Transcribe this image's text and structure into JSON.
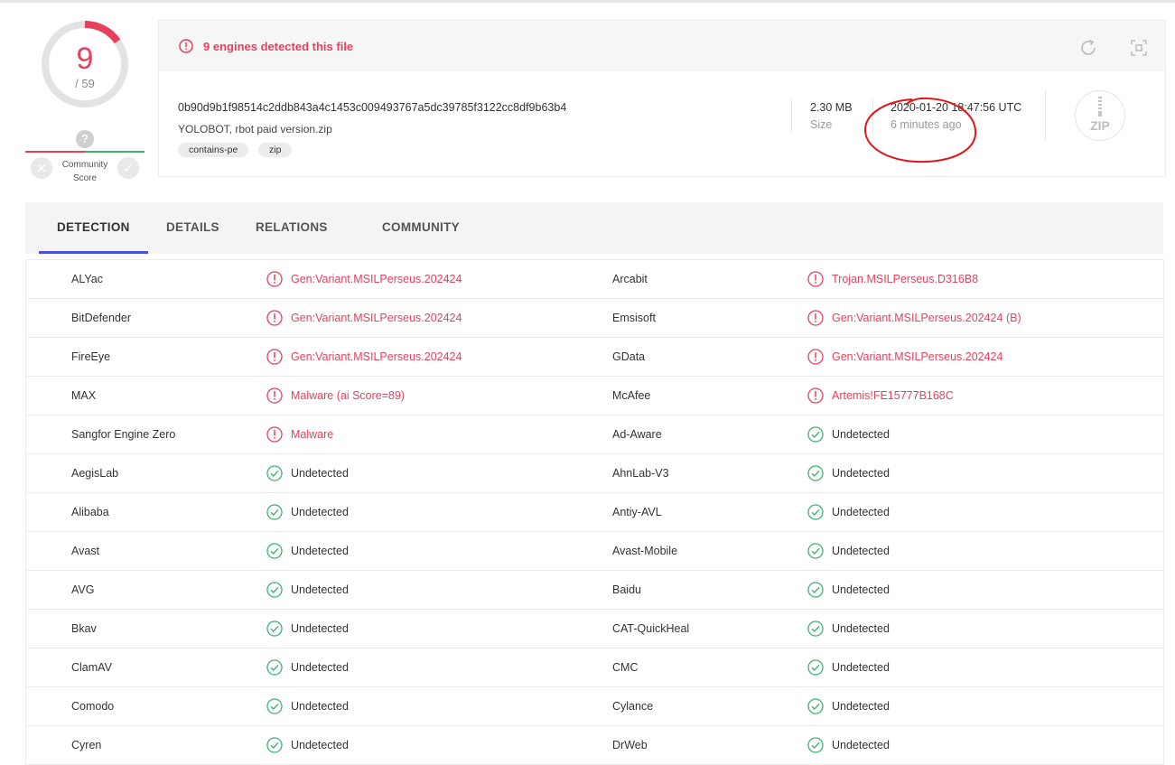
{
  "score": {
    "detected": "9",
    "total": "/ 59",
    "community_label": "Community Score",
    "community_q": "?"
  },
  "header": {
    "alert_text": "9 engines detected this file",
    "hash": "0b90d9b1f98514c2ddb843a4c1453c009493767a5dc39785f3122cc8df9b63b4",
    "filename": "YOLOBOT, rbot paid version.zip",
    "tags": [
      "contains-pe",
      "zip"
    ],
    "size_value": "2.30 MB",
    "size_label": "Size",
    "date_value": "2020-01-20 18:47:56 UTC",
    "date_label": "6 minutes ago",
    "file_type": "ZIP"
  },
  "tabs": [
    "DETECTION",
    "DETAILS",
    "RELATIONS",
    "COMMUNITY"
  ],
  "colors": {
    "detected": "#e5415d",
    "clean": "#3eb273",
    "tab_accent": "#4b4fe2",
    "annotation": "#e0161b"
  },
  "detections": [
    {
      "l_engine": "ALYac",
      "l_result": "Gen:Variant.MSILPerseus.202424",
      "l_detected": true,
      "r_engine": "Arcabit",
      "r_result": "Trojan.MSILPerseus.D316B8",
      "r_detected": true
    },
    {
      "l_engine": "BitDefender",
      "l_result": "Gen:Variant.MSILPerseus.202424",
      "l_detected": true,
      "r_engine": "Emsisoft",
      "r_result": "Gen:Variant.MSILPerseus.202424 (B)",
      "r_detected": true
    },
    {
      "l_engine": "FireEye",
      "l_result": "Gen:Variant.MSILPerseus.202424",
      "l_detected": true,
      "r_engine": "GData",
      "r_result": "Gen:Variant.MSILPerseus.202424",
      "r_detected": true
    },
    {
      "l_engine": "MAX",
      "l_result": "Malware (ai Score=89)",
      "l_detected": true,
      "r_engine": "McAfee",
      "r_result": "Artemis!FE15777B168C",
      "r_detected": true
    },
    {
      "l_engine": "Sangfor Engine Zero",
      "l_result": "Malware",
      "l_detected": true,
      "r_engine": "Ad-Aware",
      "r_result": "Undetected",
      "r_detected": false
    },
    {
      "l_engine": "AegisLab",
      "l_result": "Undetected",
      "l_detected": false,
      "r_engine": "AhnLab-V3",
      "r_result": "Undetected",
      "r_detected": false
    },
    {
      "l_engine": "Alibaba",
      "l_result": "Undetected",
      "l_detected": false,
      "r_engine": "Antiy-AVL",
      "r_result": "Undetected",
      "r_detected": false
    },
    {
      "l_engine": "Avast",
      "l_result": "Undetected",
      "l_detected": false,
      "r_engine": "Avast-Mobile",
      "r_result": "Undetected",
      "r_detected": false
    },
    {
      "l_engine": "AVG",
      "l_result": "Undetected",
      "l_detected": false,
      "r_engine": "Baidu",
      "r_result": "Undetected",
      "r_detected": false
    },
    {
      "l_engine": "Bkav",
      "l_result": "Undetected",
      "l_detected": false,
      "r_engine": "CAT-QuickHeal",
      "r_result": "Undetected",
      "r_detected": false
    },
    {
      "l_engine": "ClamAV",
      "l_result": "Undetected",
      "l_detected": false,
      "r_engine": "CMC",
      "r_result": "Undetected",
      "r_detected": false
    },
    {
      "l_engine": "Comodo",
      "l_result": "Undetected",
      "l_detected": false,
      "r_engine": "Cylance",
      "r_result": "Undetected",
      "r_detected": false
    },
    {
      "l_engine": "Cyren",
      "l_result": "Undetected",
      "l_detected": false,
      "r_engine": "DrWeb",
      "r_result": "Undetected",
      "r_detected": false
    }
  ]
}
